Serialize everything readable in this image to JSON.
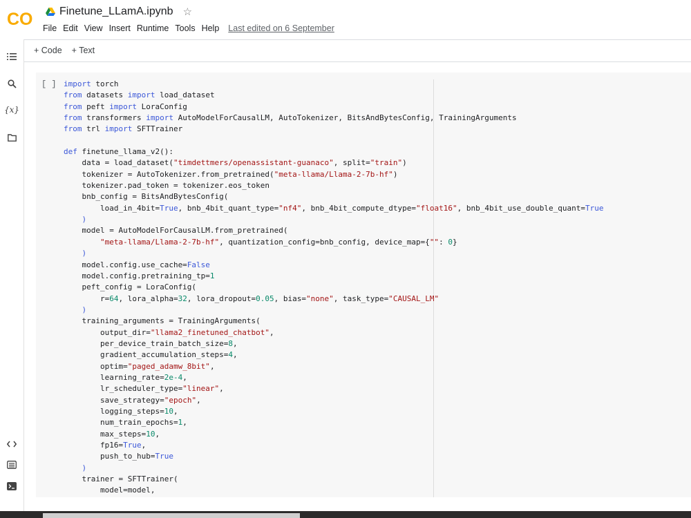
{
  "header": {
    "logo_text": "CO",
    "notebook_title": "Finetune_LLamA.ipynb",
    "star_icon": "star-outline-icon",
    "menu": [
      "File",
      "Edit",
      "View",
      "Insert",
      "Runtime",
      "Tools",
      "Help"
    ],
    "last_edited": "Last edited on 6 September"
  },
  "toolbar": {
    "code_label": "+ Code",
    "text_label": "+ Text"
  },
  "rail": {
    "variables_label": "{x}"
  },
  "cell": {
    "run_label": "[ ]",
    "language": "python"
  },
  "colors": {
    "keyword": "#3b57d8",
    "string": "#a31515",
    "number": "#0a8a6a",
    "logo_orange": "#f9ab00"
  },
  "code_lines": [
    [
      [
        "kw",
        "import"
      ],
      [
        "t",
        " torch"
      ]
    ],
    [
      [
        "kw",
        "from"
      ],
      [
        "t",
        " datasets "
      ],
      [
        "kw",
        "import"
      ],
      [
        "t",
        " load_dataset"
      ]
    ],
    [
      [
        "kw",
        "from"
      ],
      [
        "t",
        " peft "
      ],
      [
        "kw",
        "import"
      ],
      [
        "t",
        " LoraConfig"
      ]
    ],
    [
      [
        "kw",
        "from"
      ],
      [
        "t",
        " transformers "
      ],
      [
        "kw",
        "import"
      ],
      [
        "t",
        " AutoModelForCausalLM, AutoTokenizer, BitsAndBytesConfig, TrainingArguments"
      ]
    ],
    [
      [
        "kw",
        "from"
      ],
      [
        "t",
        " trl "
      ],
      [
        "kw",
        "import"
      ],
      [
        "t",
        " SFTTrainer"
      ]
    ],
    [],
    [
      [
        "kw",
        "def"
      ],
      [
        "t",
        " finetune_llama_v2():"
      ]
    ],
    [
      [
        "t",
        "    data = load_dataset("
      ],
      [
        "st",
        "\"timdettmers/openassistant-guanaco\""
      ],
      [
        "t",
        ", split="
      ],
      [
        "st",
        "\"train\""
      ],
      [
        "t",
        ")"
      ]
    ],
    [
      [
        "t",
        "    tokenizer = AutoTokenizer.from_pretrained("
      ],
      [
        "st",
        "\"meta-llama/Llama-2-7b-hf\""
      ],
      [
        "t",
        ")"
      ]
    ],
    [
      [
        "t",
        "    tokenizer.pad_token = tokenizer.eos_token"
      ]
    ],
    [
      [
        "t",
        "    bnb_config = BitsAndBytesConfig("
      ]
    ],
    [
      [
        "t",
        "        load_in_4bit="
      ],
      [
        "kw",
        "True"
      ],
      [
        "t",
        ", bnb_4bit_quant_type="
      ],
      [
        "st",
        "\"nf4\""
      ],
      [
        "t",
        ", bnb_4bit_compute_dtype="
      ],
      [
        "st",
        "\"float16\""
      ],
      [
        "t",
        ", bnb_4bit_use_double_quant="
      ],
      [
        "kw",
        "True"
      ]
    ],
    [
      [
        "t",
        "    "
      ],
      [
        "kw",
        ")"
      ]
    ],
    [
      [
        "t",
        "    model = AutoModelForCausalLM.from_pretrained("
      ]
    ],
    [
      [
        "t",
        "        "
      ],
      [
        "st",
        "\"meta-llama/Llama-2-7b-hf\""
      ],
      [
        "t",
        ", quantization_config=bnb_config, device_map={"
      ],
      [
        "st",
        "\"\""
      ],
      [
        "t",
        ": "
      ],
      [
        "nm",
        "0"
      ],
      [
        "t",
        "}"
      ]
    ],
    [
      [
        "t",
        "    "
      ],
      [
        "kw",
        ")"
      ]
    ],
    [
      [
        "t",
        "    model.config.use_cache="
      ],
      [
        "kw",
        "False"
      ]
    ],
    [
      [
        "t",
        "    model.config.pretraining_tp="
      ],
      [
        "nm",
        "1"
      ]
    ],
    [
      [
        "t",
        "    peft_config = LoraConfig("
      ]
    ],
    [
      [
        "t",
        "        r="
      ],
      [
        "nm",
        "64"
      ],
      [
        "t",
        ", lora_alpha="
      ],
      [
        "nm",
        "32"
      ],
      [
        "t",
        ", lora_dropout="
      ],
      [
        "nm",
        "0.05"
      ],
      [
        "t",
        ", bias="
      ],
      [
        "st",
        "\"none\""
      ],
      [
        "t",
        ", task_type="
      ],
      [
        "st",
        "\"CAUSAL_LM\""
      ]
    ],
    [
      [
        "t",
        "    "
      ],
      [
        "kw",
        ")"
      ]
    ],
    [
      [
        "t",
        "    training_arguments = TrainingArguments("
      ]
    ],
    [
      [
        "t",
        "        output_dir="
      ],
      [
        "st",
        "\"llama2_finetuned_chatbot\""
      ],
      [
        "t",
        ","
      ]
    ],
    [
      [
        "t",
        "        per_device_train_batch_size="
      ],
      [
        "nm",
        "8"
      ],
      [
        "t",
        ","
      ]
    ],
    [
      [
        "t",
        "        gradient_accumulation_steps="
      ],
      [
        "nm",
        "4"
      ],
      [
        "t",
        ","
      ]
    ],
    [
      [
        "t",
        "        optim="
      ],
      [
        "st",
        "\"paged_adamw_8bit\""
      ],
      [
        "t",
        ","
      ]
    ],
    [
      [
        "t",
        "        learning_rate="
      ],
      [
        "nm",
        "2e-4"
      ],
      [
        "t",
        ","
      ]
    ],
    [
      [
        "t",
        "        lr_scheduler_type="
      ],
      [
        "st",
        "\"linear\""
      ],
      [
        "t",
        ","
      ]
    ],
    [
      [
        "t",
        "        save_strategy="
      ],
      [
        "st",
        "\"epoch\""
      ],
      [
        "t",
        ","
      ]
    ],
    [
      [
        "t",
        "        logging_steps="
      ],
      [
        "nm",
        "10"
      ],
      [
        "t",
        ","
      ]
    ],
    [
      [
        "t",
        "        num_train_epochs="
      ],
      [
        "nm",
        "1"
      ],
      [
        "t",
        ","
      ]
    ],
    [
      [
        "t",
        "        max_steps="
      ],
      [
        "nm",
        "10"
      ],
      [
        "t",
        ","
      ]
    ],
    [
      [
        "t",
        "        fp16="
      ],
      [
        "kw",
        "True"
      ],
      [
        "t",
        ","
      ]
    ],
    [
      [
        "t",
        "        push_to_hub="
      ],
      [
        "kw",
        "True"
      ]
    ],
    [
      [
        "t",
        "    "
      ],
      [
        "kw",
        ")"
      ]
    ],
    [
      [
        "t",
        "    trainer = SFTTrainer("
      ]
    ],
    [
      [
        "t",
        "        model=model,"
      ]
    ]
  ]
}
